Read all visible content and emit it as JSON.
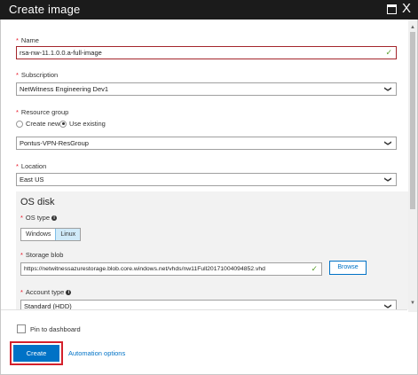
{
  "window": {
    "title": "Create image",
    "maximize_icon": "maximize-icon",
    "close_icon": "close-icon",
    "close_glyph": "X"
  },
  "form": {
    "required_mark": "*",
    "name": {
      "label": "Name",
      "value": "rsa-nw-11.1.0.0.a-full-image",
      "valid": true
    },
    "subscription": {
      "label": "Subscription",
      "value": "NetWitness Engineering Dev1"
    },
    "resource_group": {
      "label": "Resource group",
      "options": [
        "Create new",
        "Use existing"
      ],
      "selected": "Use existing",
      "value": "Pontus-VPN-ResGroup"
    },
    "location": {
      "label": "Location",
      "value": "East US"
    },
    "os_disk": {
      "title": "OS disk",
      "os_type": {
        "label": "OS type",
        "options": [
          "Windows",
          "Linux"
        ],
        "selected": "Linux"
      },
      "storage_blob": {
        "label": "Storage blob",
        "value": "https://netwitnessazurestorage.blob.core.windows.net/vhds/nw11Full20171004094852.vhd",
        "browse_label": "Browse"
      },
      "account_type": {
        "label": "Account type",
        "value": "Standard (HDD)"
      }
    }
  },
  "footer": {
    "pin_label": "Pin to dashboard",
    "pin_checked": false,
    "create_label": "Create",
    "automation_label": "Automation options"
  },
  "colors": {
    "titlebar": "#1b1b1b",
    "accent": "#0072c6",
    "required": "#e81123",
    "valid_check": "#5aa02c",
    "highlight_outline": "#d4202b",
    "toggle_selected": "#cfeaf9"
  },
  "glyphs": {
    "check": "✓",
    "chevron": "❯",
    "info": "i"
  }
}
